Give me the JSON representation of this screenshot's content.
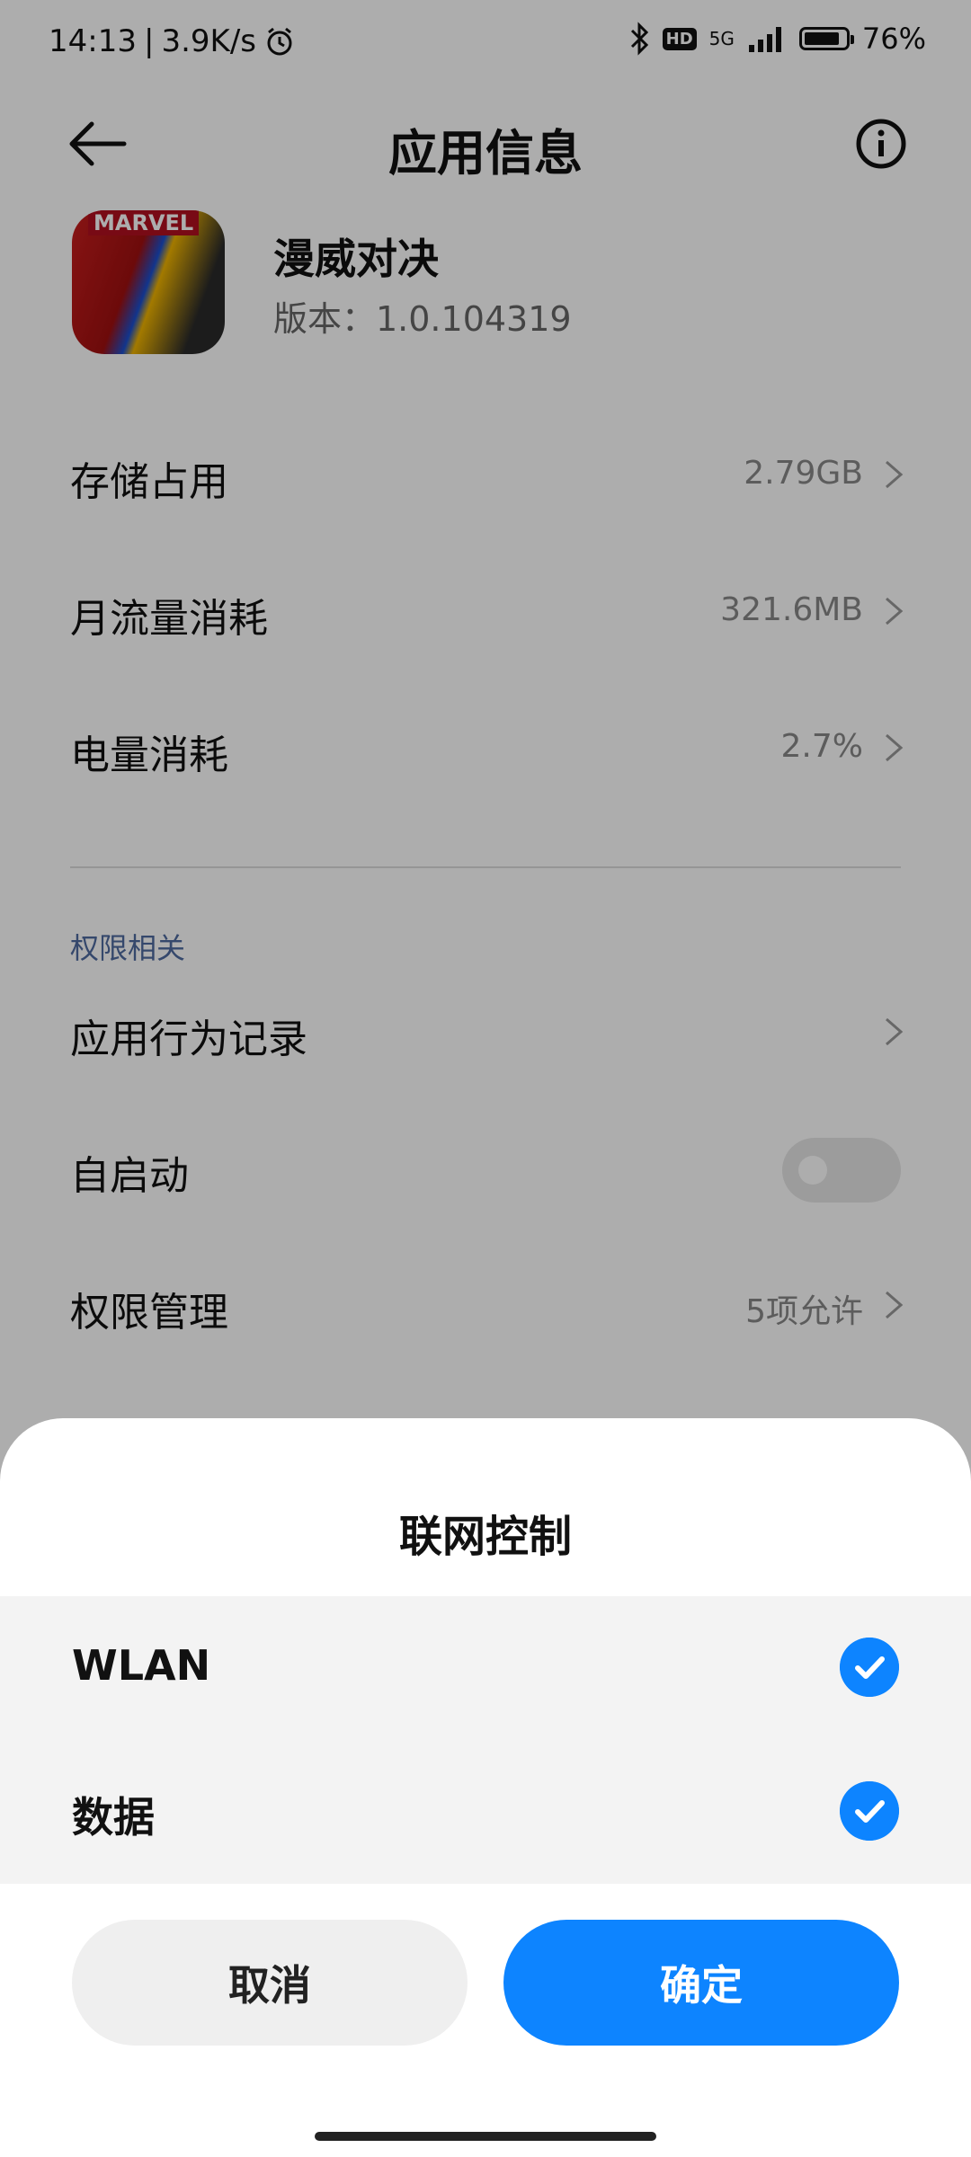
{
  "status": {
    "time": "14:13",
    "separator": "|",
    "net_speed": "3.9K/s",
    "network": "5G",
    "hd": "HD",
    "battery_text": "76%",
    "battery_level": 0.76
  },
  "header": {
    "title": "应用信息"
  },
  "app": {
    "name": "漫威对决",
    "version": "版本：1.0.104319",
    "icon_brand": "MARVEL"
  },
  "rows": {
    "storage": {
      "label": "存储占用",
      "value": "2.79GB"
    },
    "traffic": {
      "label": "月流量消耗",
      "value": "321.6MB"
    },
    "battery": {
      "label": "电量消耗",
      "value": "2.7%"
    }
  },
  "permissions": {
    "section_label": "权限相关",
    "behavior_log": {
      "label": "应用行为记录"
    },
    "autostart": {
      "label": "自启动",
      "enabled": false
    },
    "manage": {
      "label": "权限管理",
      "value": "5项允许"
    }
  },
  "sheet": {
    "title": "联网控制",
    "options": [
      {
        "label": "WLAN",
        "checked": true
      },
      {
        "label": "数据",
        "checked": true
      }
    ],
    "cancel_label": "取消",
    "ok_label": "确定"
  },
  "colors": {
    "accent": "#0d84ff",
    "section": "#4f6aa0"
  }
}
